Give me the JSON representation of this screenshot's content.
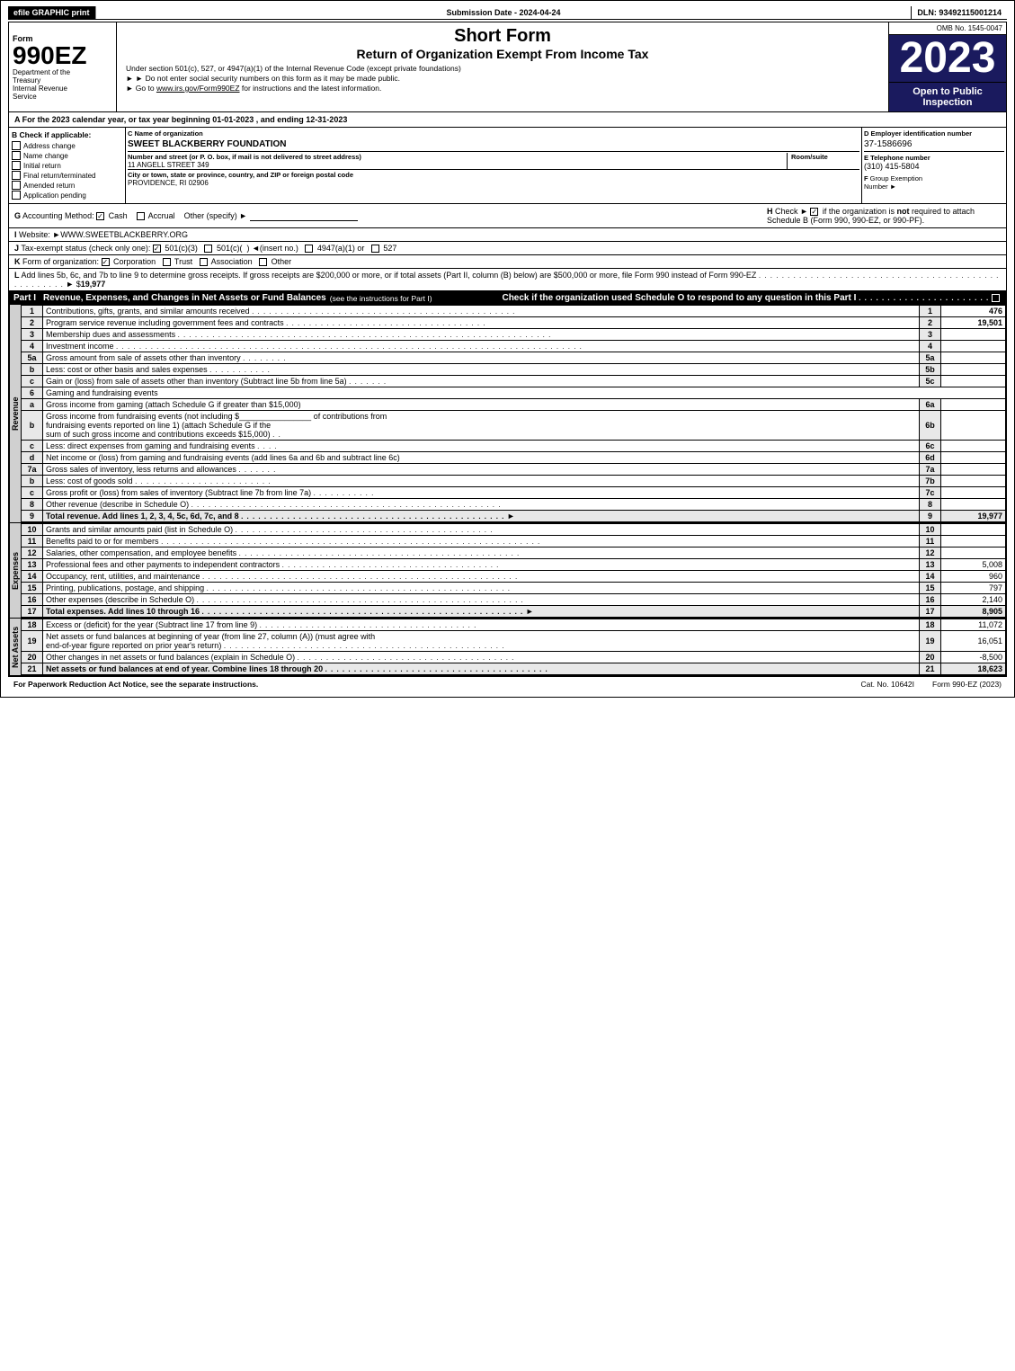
{
  "header": {
    "efile_label": "efile GRAPHIC print",
    "submission_label": "Submission Date - 2024-04-24",
    "dln_label": "DLN: 93492115001214",
    "form_number": "990EZ",
    "dept_line1": "Department of the",
    "dept_line2": "Treasury",
    "dept_line3": "Internal Revenue",
    "dept_line4": "Service",
    "title_main": "Short Form",
    "title_sub": "Return of Organization Exempt From Income Tax",
    "instruction1": "Under section 501(c), 527, or 4947(a)(1) of the Internal Revenue Code (except private foundations)",
    "instruction2": "► Do not enter social security numbers on this form as it may be made public.",
    "instruction3": "► Go to www.irs.gov/Form990EZ for instructions and the latest information.",
    "omb": "OMB No. 1545-0047",
    "year": "2023",
    "open_public": "Open to Public Inspection"
  },
  "section_a": {
    "label": "A",
    "text": "For the 2023 calendar year, or tax year beginning 01-01-2023 , and ending 12-31-2023"
  },
  "section_b": {
    "label": "B",
    "sublabel": "Check if applicable:",
    "items": [
      {
        "id": "address_change",
        "label": "Address change",
        "checked": false
      },
      {
        "id": "name_change",
        "label": "Name change",
        "checked": false
      },
      {
        "id": "initial_return",
        "label": "Initial return",
        "checked": false
      },
      {
        "id": "final_return",
        "label": "Final return/terminated",
        "checked": false
      },
      {
        "id": "amended_return",
        "label": "Amended return",
        "checked": false
      },
      {
        "id": "app_pending",
        "label": "Application pending",
        "checked": false
      }
    ]
  },
  "section_c": {
    "label": "C",
    "sublabel": "Name of organization",
    "org_name": "SWEET BLACKBERRY FOUNDATION",
    "address_label": "Number and street (or P. O. box, if mail is not delivered to street address)",
    "address_val": "11 ANGELL STREET 349",
    "room_label": "Room/suite",
    "room_val": "",
    "city_label": "City or town, state or province, country, and ZIP or foreign postal code",
    "city_val": "PROVIDENCE, RI  02906"
  },
  "section_d": {
    "label": "D",
    "sublabel": "Employer identification number",
    "ein": "37-1586696",
    "phone_label": "E Telephone number",
    "phone": "(310) 415-5804",
    "fgroup_label": "F Group Exemption Number",
    "fgroup_arrow": "►"
  },
  "section_g": {
    "label": "G",
    "text": "Accounting Method:",
    "cash": "Cash",
    "accrual": "Accrual",
    "other": "Other (specify) ►",
    "cash_checked": true,
    "accrual_checked": false
  },
  "section_h": {
    "label": "H",
    "text": "Check ►",
    "text2": "if the organization is not required to attach Schedule B",
    "text3": "(Form 990, 990-EZ, or 990-PF)."
  },
  "section_i": {
    "label": "I",
    "text": "Website: ►WWW.SWEETBLACKBERRY.ORG"
  },
  "section_j": {
    "label": "J",
    "text": "Tax-exempt status (check only one):",
    "options": [
      "501(c)(3)",
      "501(c)(  ) ◄(insert no.)",
      "4947(a)(1) or",
      "527"
    ],
    "checked": "501(c)(3)"
  },
  "section_k": {
    "label": "K",
    "text": "Form of organization:",
    "options": [
      "Corporation",
      "Trust",
      "Association",
      "Other"
    ],
    "checked": "Corporation"
  },
  "section_l": {
    "text": "L Add lines 5b, 6c, and 7b to line 9 to determine gross receipts. If gross receipts are $200,000 or more, or if total assets (Part II, column (B) below) are $500,000 or more, file Form 990 instead of Form 990-EZ",
    "dots": ". . . . . . . . . . . . . . . . . . . . . . . . . . . . . . . . . . . . . . . . . . . . . . . . . .",
    "arrow": "► $",
    "value": "19,977"
  },
  "part1": {
    "label": "Part I",
    "title": "Revenue, Expenses, and Changes in Net Assets or Fund Balances",
    "subtitle": "(see the instructions for Part I)",
    "check_text": "Check if the organization used Schedule O to respond to any question in this Part I",
    "dots": ". . . . . . . . . . . . . . . . . . . . . . .",
    "rows": [
      {
        "num": "1",
        "desc": "Contributions, gifts, grants, and similar amounts received",
        "dots": true,
        "line": "1",
        "val": "476"
      },
      {
        "num": "2",
        "desc": "Program service revenue including government fees and contracts",
        "dots": true,
        "line": "2",
        "val": "19,501"
      },
      {
        "num": "3",
        "desc": "Membership dues and assessments",
        "dots": true,
        "line": "3",
        "val": ""
      },
      {
        "num": "4",
        "desc": "Investment income",
        "dots": true,
        "line": "4",
        "val": ""
      },
      {
        "num": "5a",
        "desc": "Gross amount from sale of assets other than inventory",
        "sub": "5a",
        "val5": "",
        "line": "",
        "val": ""
      },
      {
        "num": "5b",
        "desc": "Less: cost or other basis and sales expenses",
        "sub": "5b",
        "val5": "",
        "line": "",
        "val": ""
      },
      {
        "num": "5c",
        "desc": "Gain or (loss) from sale of assets other than inventory (Subtract line 5b from line 5a)",
        "dots": true,
        "line": "5c",
        "val": ""
      },
      {
        "num": "6",
        "desc": "Gaming and fundraising events",
        "line": "",
        "val": ""
      }
    ],
    "rows6": [
      {
        "sub": "a",
        "desc": "Gross income from gaming (attach Schedule G if greater than $15,000)",
        "sub_num": "6a",
        "val": ""
      },
      {
        "sub": "b",
        "desc": "Gross income from fundraising events (not including $_______ of contributions from fundraising events reported on line 1) (attach Schedule G if the sum of such gross income and contributions exceeds $15,000)",
        "sub_num": "6b",
        "val": ""
      },
      {
        "sub": "c",
        "desc": "Less: direct expenses from gaming and fundraising events",
        "sub_num": "6c",
        "val": ""
      },
      {
        "sub": "d",
        "desc": "Net income or (loss) from gaming and fundraising events (add lines 6a and 6b and subtract line 6c)",
        "line": "6d",
        "val": ""
      }
    ],
    "rows7": [
      {
        "sub": "a",
        "desc": "Gross sales of inventory, less returns and allowances",
        "sub_num": "7a",
        "val": ""
      },
      {
        "sub": "b",
        "desc": "Less: cost of goods sold",
        "sub_num": "7b",
        "val": ""
      },
      {
        "sub": "c",
        "desc": "Gross profit or (loss) from sales of inventory (Subtract line 7b from line 7a)",
        "dots": true,
        "line": "7c",
        "val": ""
      }
    ],
    "rows8": [
      {
        "num": "8",
        "desc": "Other revenue (describe in Schedule O)",
        "dots": true,
        "line": "8",
        "val": ""
      },
      {
        "num": "9",
        "desc": "Total revenue. Add lines 1, 2, 3, 4, 5c, 6d, 7c, and 8",
        "dots": true,
        "arrow": "►",
        "line": "9",
        "val": "19,977"
      }
    ]
  },
  "expenses": {
    "label": "Expenses",
    "rows": [
      {
        "num": "10",
        "desc": "Grants and similar amounts paid (list in Schedule O)",
        "dots": true,
        "line": "10",
        "val": ""
      },
      {
        "num": "11",
        "desc": "Benefits paid to or for members",
        "dots": true,
        "line": "11",
        "val": ""
      },
      {
        "num": "12",
        "desc": "Salaries, other compensation, and employee benefits",
        "dots": true,
        "line": "12",
        "val": ""
      },
      {
        "num": "13",
        "desc": "Professional fees and other payments to independent contractors",
        "dots": true,
        "line": "13",
        "val": "5,008"
      },
      {
        "num": "14",
        "desc": "Occupancy, rent, utilities, and maintenance",
        "dots": true,
        "line": "14",
        "val": "960"
      },
      {
        "num": "15",
        "desc": "Printing, publications, postage, and shipping",
        "dots": true,
        "line": "15",
        "val": "797"
      },
      {
        "num": "16",
        "desc": "Other expenses (describe in Schedule O)",
        "dots": true,
        "line": "16",
        "val": "2,140"
      },
      {
        "num": "17",
        "desc": "Total expenses. Add lines 10 through 16",
        "dots": true,
        "arrow": "►",
        "line": "17",
        "val": "8,905"
      }
    ]
  },
  "net_assets": {
    "label": "Net Assets",
    "rows": [
      {
        "num": "18",
        "desc": "Excess or (deficit) for the year (Subtract line 17 from line 9)",
        "dots": true,
        "line": "18",
        "val": "11,072"
      },
      {
        "num": "19",
        "desc": "Net assets or fund balances at beginning of year (from line 27, column (A)) (must agree with end-of-year figure reported on prior year's return)",
        "dots": true,
        "line": "19",
        "val": "16,051"
      },
      {
        "num": "20",
        "desc": "Other changes in net assets or fund balances (explain in Schedule O)",
        "dots": true,
        "line": "20",
        "val": "-8,500"
      },
      {
        "num": "21",
        "desc": "Net assets or fund balances at end of year. Combine lines 18 through 20",
        "dots": true,
        "line": "21",
        "val": "18,623"
      }
    ]
  },
  "footer": {
    "left": "For Paperwork Reduction Act Notice, see the separate instructions.",
    "cat": "Cat. No. 10642I",
    "right": "Form 990-EZ (2023)"
  }
}
